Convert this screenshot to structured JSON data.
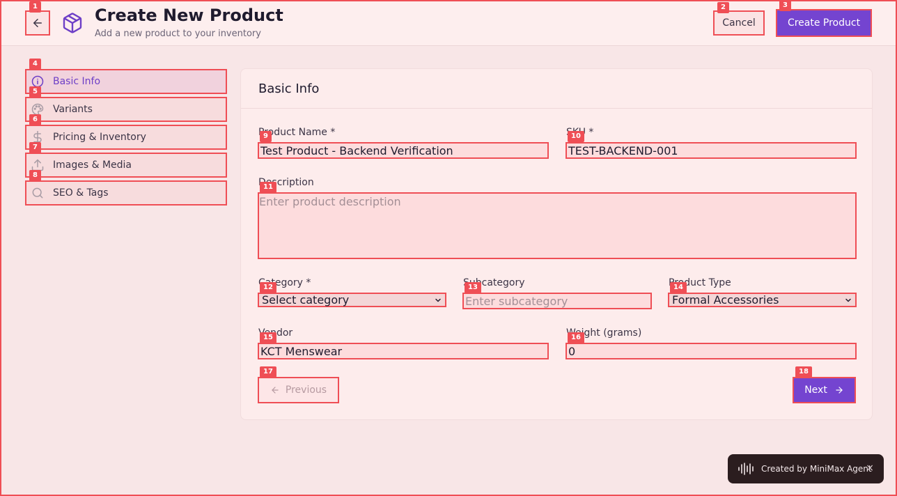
{
  "header": {
    "title": "Create New Product",
    "subtitle": "Add a new product to your inventory",
    "cancel_label": "Cancel",
    "create_label": "Create Product"
  },
  "sidebar": {
    "items": [
      {
        "label": "Basic Info",
        "icon": "info-icon",
        "active": true
      },
      {
        "label": "Variants",
        "icon": "palette-icon"
      },
      {
        "label": "Pricing & Inventory",
        "icon": "dollar-icon"
      },
      {
        "label": "Images & Media",
        "icon": "upload-icon"
      },
      {
        "label": "SEO & Tags",
        "icon": "search-icon"
      }
    ]
  },
  "card": {
    "title": "Basic Info"
  },
  "form": {
    "product_name": {
      "label": "Product Name *",
      "value": "Test Product - Backend Verification"
    },
    "sku": {
      "label": "SKU *",
      "value": "TEST-BACKEND-001"
    },
    "description": {
      "label": "Description",
      "placeholder": "Enter product description"
    },
    "category": {
      "label": "Category *",
      "selected": "Select category"
    },
    "subcategory": {
      "label": "Subcategory",
      "placeholder": "Enter subcategory"
    },
    "product_type": {
      "label": "Product Type",
      "selected": "Formal Accessories"
    },
    "vendor": {
      "label": "Vendor",
      "value": "KCT Menswear"
    },
    "weight": {
      "label": "Weight (grams)",
      "value": "0"
    }
  },
  "nav": {
    "previous_label": "Previous",
    "next_label": "Next"
  },
  "toast": {
    "text": "Created by MiniMax Agent",
    "close": "×"
  },
  "tags": [
    "1",
    "2",
    "3",
    "4",
    "5",
    "6",
    "7",
    "8",
    "9",
    "10",
    "11",
    "12",
    "13",
    "14",
    "15",
    "16",
    "17",
    "18"
  ],
  "colors": {
    "accent": "#7444d0",
    "highlight": "#ef4e55",
    "background": "#f8e6e7"
  }
}
